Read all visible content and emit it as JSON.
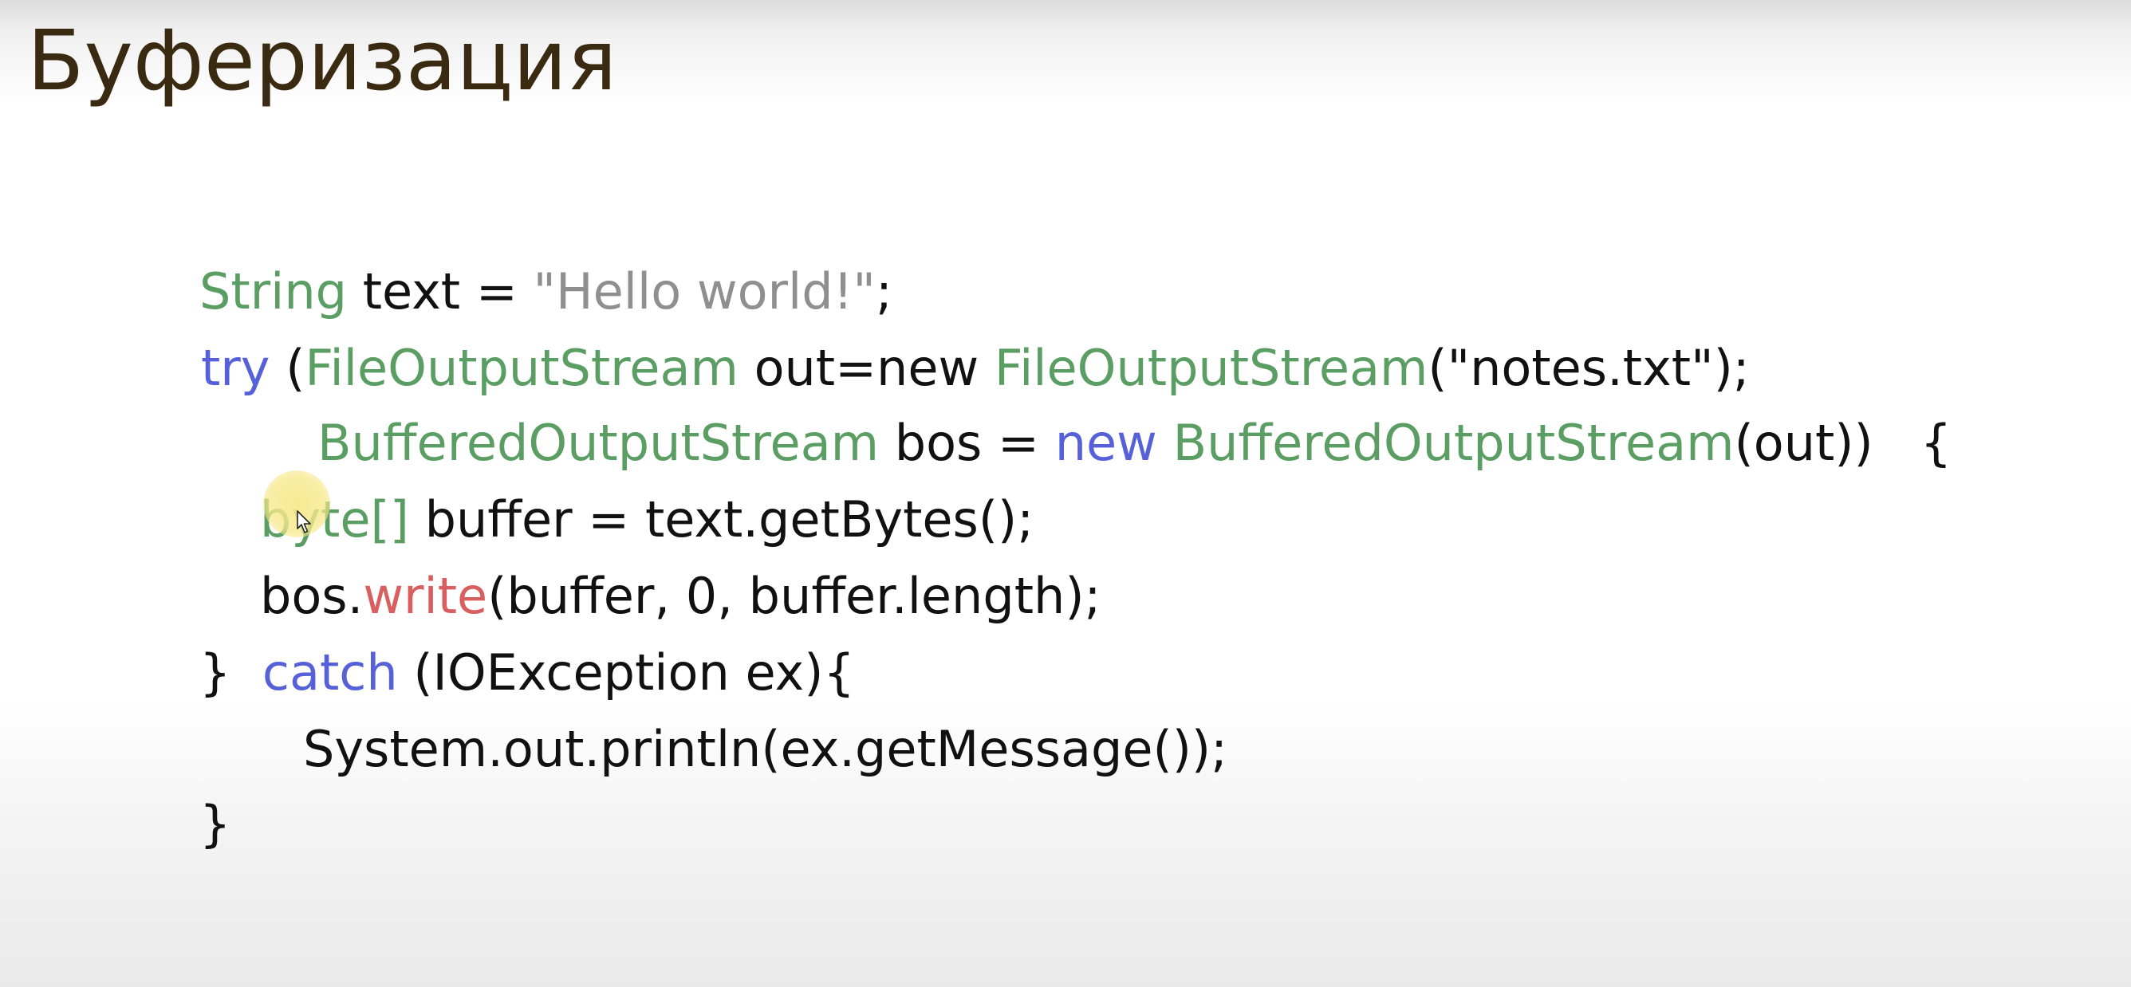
{
  "slide": {
    "title": "Буферизация"
  },
  "code": {
    "line1": {
      "type": "String",
      "rest": " text = ",
      "literal": "\"Hello world!\"",
      "end": ";"
    },
    "line2": {
      "kw": "try",
      "open": " (",
      "type": "FileOutputStream",
      "mid": " out=new ",
      "type2": "FileOutputStream",
      "end": "(\"notes.txt\");"
    },
    "line3": {
      "type": "BufferedOutputStream",
      "mid": " bos = ",
      "kw": "new",
      "space": " ",
      "type2": "BufferedOutputStream",
      "end": "(out))   {"
    },
    "line4": {
      "type": "byte[]",
      "rest": " buffer = text.getBytes();"
    },
    "line5": {
      "obj": "bos.",
      "method": "write",
      "rest": "(buffer, 0, buffer.length);"
    },
    "line6": {
      "brace": "}  ",
      "kw": "catch",
      "rest": " (IOException ex){"
    },
    "line7": {
      "text": "System.out.println(ex.getMessage());"
    },
    "line8": {
      "text": "}"
    }
  },
  "colors": {
    "type": "#5b9e63",
    "keyword": "#5560d9",
    "string": "#8f8f8f",
    "method": "#d95f5f",
    "title": "#3b2a12",
    "cursor_highlight": "#f7e88a"
  },
  "icons": {
    "cursor": "mouse-pointer-icon"
  }
}
